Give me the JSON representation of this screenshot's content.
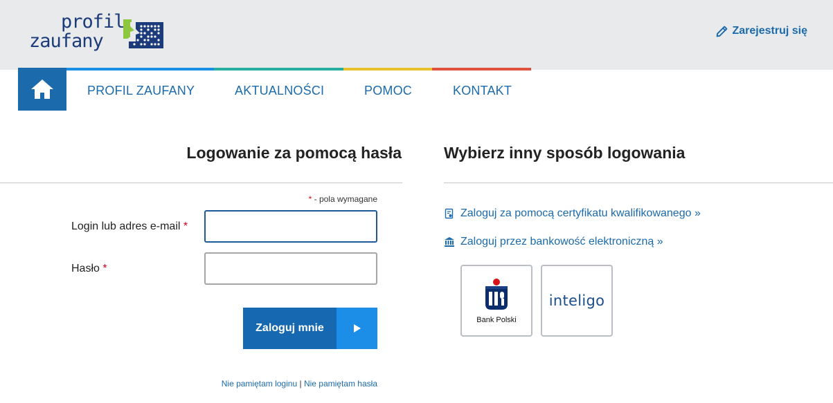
{
  "header": {
    "logo_line1": "profil",
    "logo_line2": "zaufany",
    "register_label": "Zarejestruj się"
  },
  "nav": {
    "items": [
      "PROFIL ZAUFANY",
      "AKTUALNOŚCI",
      "POMOC",
      "KONTAKT"
    ],
    "colors": [
      "#1a8fe3",
      "#27b0a0",
      "#e8c22d",
      "#e0523c"
    ]
  },
  "login": {
    "title": "Logowanie za pomocą hasła",
    "required_mark": "*",
    "required_note": " - pola wymagane",
    "login_label": "Login lub adres e-mail",
    "login_value": "",
    "password_label": "Hasło",
    "password_value": "",
    "submit_label": "Zaloguj mnie",
    "forgot_login": "Nie pamiętam loginu",
    "separator": "|",
    "forgot_password": "Nie pamiętam hasła"
  },
  "alternatives": {
    "title": "Wybierz inny sposób logowania",
    "certificate_link": "Zaloguj za pomocą certyfikatu kwalifikowanego »",
    "bank_link": "Zaloguj przez bankowość elektroniczną »",
    "banks": [
      {
        "name": "Bank Polski",
        "icon": "pko-bp-logo"
      },
      {
        "name": "inteligo",
        "icon": "inteligo-logo"
      }
    ]
  },
  "colors": {
    "primary": "#1669b0",
    "accent": "#1c8ee8",
    "required": "#d0021b"
  }
}
